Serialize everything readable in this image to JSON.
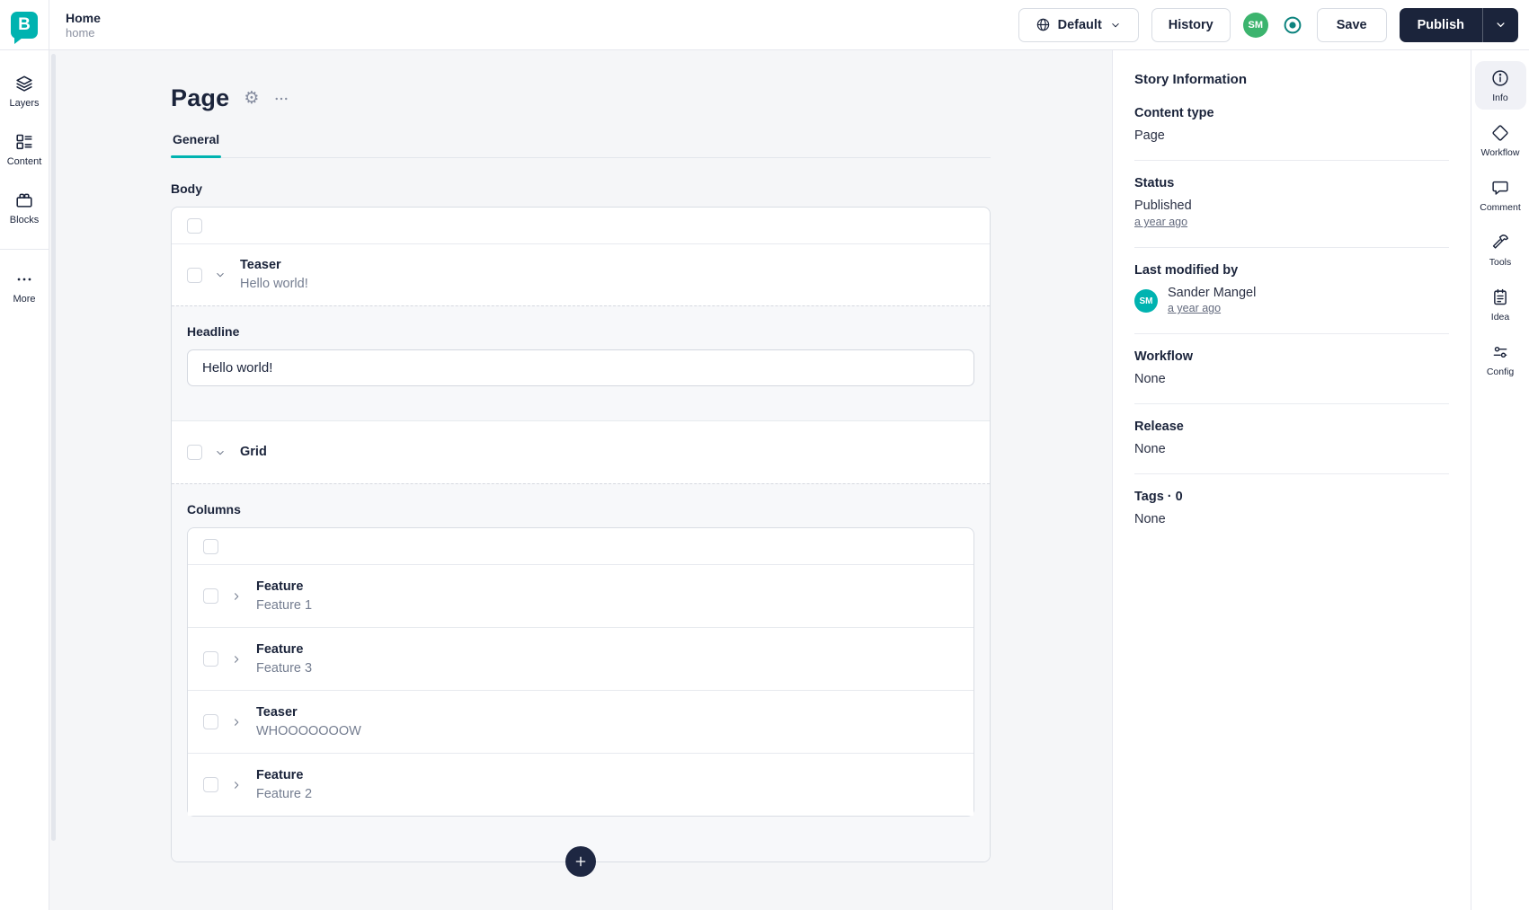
{
  "topbar": {
    "breadcrumb": {
      "title": "Home",
      "slug": "home"
    },
    "language": {
      "label": "Default"
    },
    "history_label": "History",
    "user_initials": "SM",
    "save_label": "Save",
    "publish_label": "Publish"
  },
  "left_rail": {
    "items": [
      {
        "icon": "layers-icon",
        "label": "Layers"
      },
      {
        "icon": "content-icon",
        "label": "Content"
      },
      {
        "icon": "blocks-icon",
        "label": "Blocks"
      },
      {
        "icon": "more-icon",
        "label": "More"
      }
    ]
  },
  "editor": {
    "title": "Page",
    "tab_general": "General",
    "body_label": "Body",
    "teaser_block": {
      "type": "Teaser",
      "subtitle": "Hello world!"
    },
    "headline": {
      "label": "Headline",
      "value": "Hello world!"
    },
    "grid_block": {
      "type": "Grid"
    },
    "columns_label": "Columns",
    "column_blocks": [
      {
        "type": "Feature",
        "subtitle": "Feature 1"
      },
      {
        "type": "Feature",
        "subtitle": "Feature 3"
      },
      {
        "type": "Teaser",
        "subtitle": "WHOOOOOOOW"
      },
      {
        "type": "Feature",
        "subtitle": "Feature 2"
      }
    ]
  },
  "story_info": {
    "title": "Story Information",
    "content_type": {
      "label": "Content type",
      "value": "Page"
    },
    "status": {
      "label": "Status",
      "value": "Published",
      "time": "a year ago"
    },
    "last_modified": {
      "label": "Last modified by",
      "user": "Sander Mangel",
      "initials": "SM",
      "time": "a year ago"
    },
    "workflow": {
      "label": "Workflow",
      "value": "None"
    },
    "release": {
      "label": "Release",
      "value": "None"
    },
    "tags": {
      "label": "Tags · 0",
      "value": "None"
    }
  },
  "right_rail": {
    "items": [
      {
        "icon": "info-icon",
        "label": "Info",
        "active": true
      },
      {
        "icon": "workflow-icon",
        "label": "Workflow",
        "active": false
      },
      {
        "icon": "comment-icon",
        "label": "Comment",
        "active": false
      },
      {
        "icon": "tools-icon",
        "label": "Tools",
        "active": false
      },
      {
        "icon": "idea-icon",
        "label": "Idea",
        "active": false
      },
      {
        "icon": "config-icon",
        "label": "Config",
        "active": false
      }
    ]
  },
  "colors": {
    "brand_teal": "#00b3b0",
    "navy": "#1b243b",
    "avatar_green": "#3cb46e",
    "preview_toggle_teal": "#0c837e",
    "muted_text": "#747d90",
    "canvas_bg": "#f5f6f8"
  }
}
